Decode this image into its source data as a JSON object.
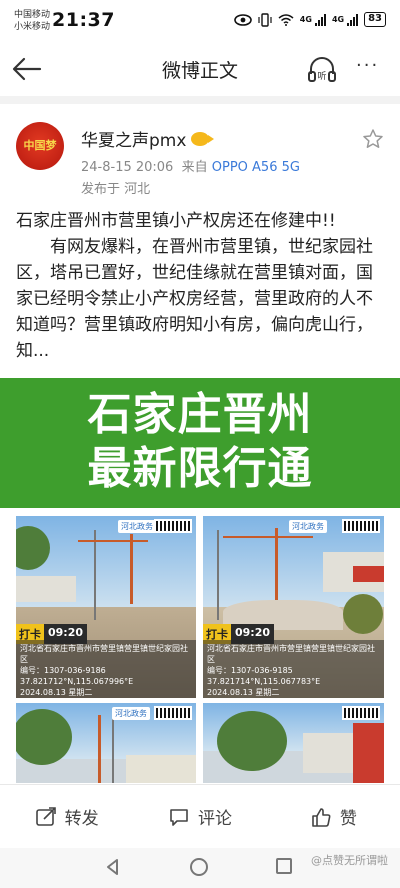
{
  "status_bar": {
    "carrier1": "中国移动",
    "carrier2": "小米移动",
    "time": "21:37",
    "net1": "4G",
    "net2": "4G",
    "battery": "83"
  },
  "nav": {
    "title": "微博正文",
    "listen_label": "听",
    "more_label": "···"
  },
  "post": {
    "avatar_text": "中国梦",
    "author": "华夏之声pmx",
    "datetime": "24-8-15 20:06",
    "source_prefix": "来自",
    "device": "OPPO A56 5G",
    "location": "发布于 河北",
    "title_line": "石家庄晋州市营里镇小产权房还在修建中!!",
    "body": "有网友爆料，在晋州市营里镇，世纪家园社区，塔吊已置好，世纪佳缘就在营里镇对面，国家已经明令禁止小产权房经营，营里政府的人不知道吗？营里镇政府明知小有房，偏向虎山行，知..."
  },
  "overlay": {
    "line1": "石家庄晋州",
    "line2": "最新限行通"
  },
  "photos": [
    {
      "qr_label": "河北政务",
      "punch_label": "打卡",
      "punch_time": "09:20",
      "address": "河北省石家庄市晋州市营里镇营里镇世纪家园社区",
      "code": "编号：1307-036-9186",
      "coords": "37.821712°N,115.067996°E",
      "date": "2024.08.13 星期二"
    },
    {
      "qr_label": "河北政务",
      "punch_label": "打卡",
      "punch_time": "09:20",
      "address": "河北省石家庄市晋州市营里镇营里镇世纪家园社区",
      "code": "编号：1307-036-9185",
      "coords": "37.821714°N,115.067783°E",
      "date": "2024.08.13 星期二"
    },
    {
      "qr_label": "河北政务"
    },
    {
      "qr_label": ""
    }
  ],
  "actions": {
    "repost": "转发",
    "comment": "评论",
    "like": "赞"
  },
  "watermark": "@点赞无所谓啦"
}
